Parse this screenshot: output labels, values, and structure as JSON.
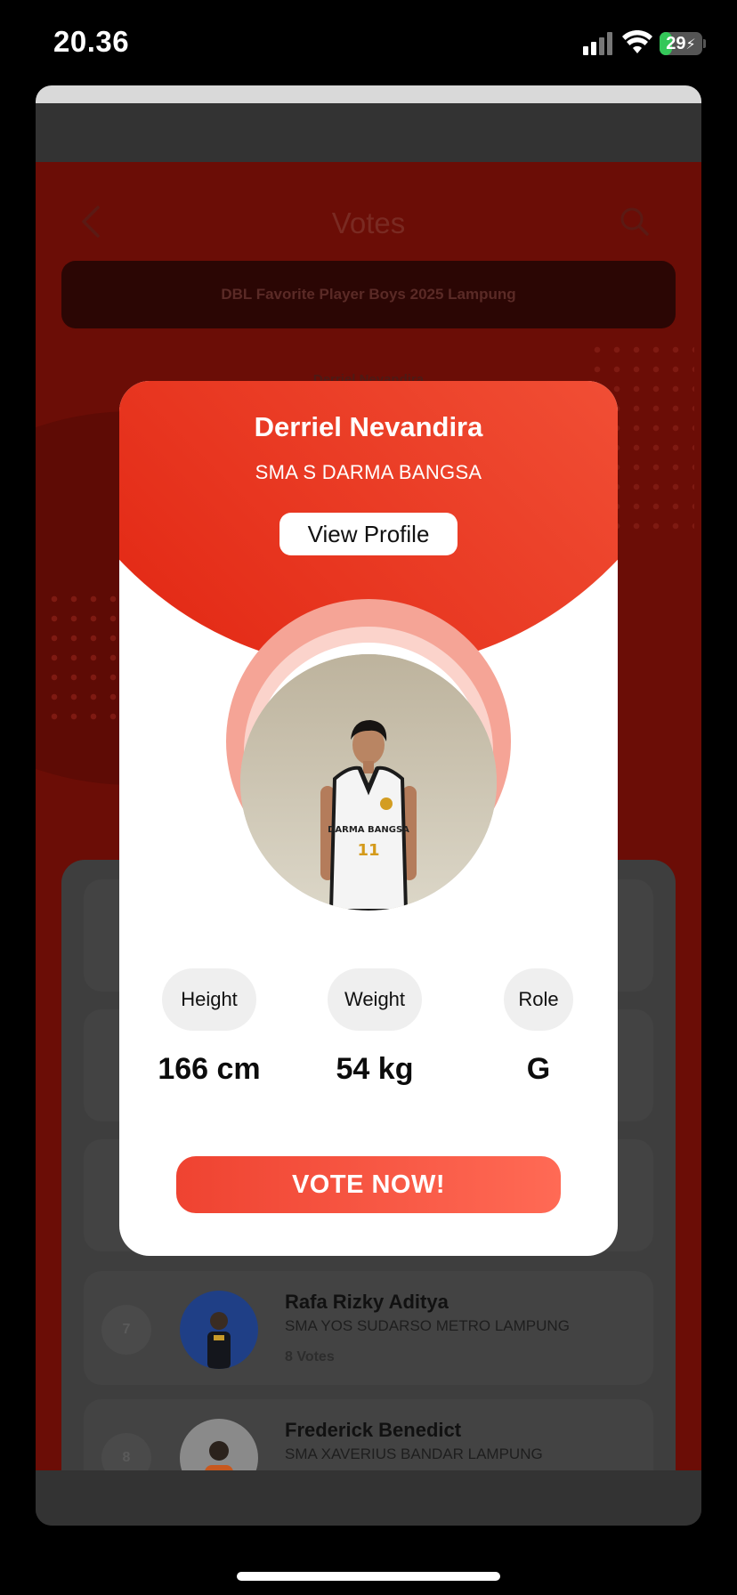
{
  "status_bar": {
    "time": "20.36",
    "battery": "29",
    "battery_level": 0.29
  },
  "app": {
    "title": "Votes",
    "event_title": "DBL Favorite Player Boys 2025 Lampung",
    "background_name": "Derriel Nevandira",
    "colors": {
      "brand_red": "#ef4a31",
      "overlay_dark": "#2a2a2a"
    }
  },
  "list": {
    "items": [
      {
        "rank": "7",
        "name": "Rafa Rizky Aditya",
        "school": "SMA YOS SUDARSO METRO LAMPUNG",
        "votes": "8 Votes",
        "avatar_bg": "#1f3f86"
      },
      {
        "rank": "8",
        "name": "Frederick Benedict",
        "school": "SMA XAVERIUS BANDAR LAMPUNG",
        "votes": "",
        "avatar_bg": "#8a8a8a"
      }
    ]
  },
  "modal": {
    "name": "Derriel Nevandira",
    "school": "SMA S DARMA BANGSA",
    "view_profile_label": "View Profile",
    "jersey_text": "DARMA BANGSA",
    "jersey_number": "11",
    "stats": [
      {
        "label": "Height",
        "value": "166 cm"
      },
      {
        "label": "Weight",
        "value": "54 kg"
      },
      {
        "label": "Role",
        "value": "G"
      }
    ],
    "vote_label": "VOTE NOW!"
  },
  "icons": [
    "back-icon",
    "search-icon",
    "wifi-icon",
    "signal-icon",
    "battery-icon",
    "bolt-icon"
  ]
}
